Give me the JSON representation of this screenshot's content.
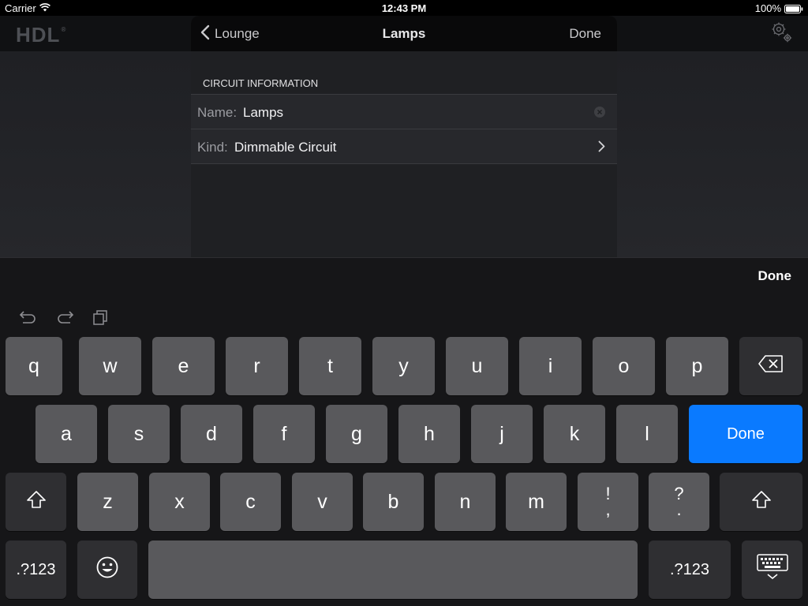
{
  "status_bar": {
    "carrier": "Carrier",
    "time": "12:43 PM",
    "battery": "100%"
  },
  "header": {
    "logo_text": "HDL",
    "logo_mark": "®",
    "settings_icon": "gear-icon"
  },
  "modal": {
    "back_label": "Lounge",
    "title": "Lamps",
    "done_label": "Done",
    "section_header": "CIRCUIT INFORMATION",
    "rows": [
      {
        "label": "Name:",
        "value": "Lamps"
      },
      {
        "label": "Kind:",
        "value": "Dimmable Circuit"
      }
    ]
  },
  "keyboard": {
    "done_label": "Done",
    "row1": [
      "q",
      "w",
      "e",
      "r",
      "t",
      "y",
      "u",
      "i",
      "o",
      "p"
    ],
    "row2": [
      "a",
      "s",
      "d",
      "f",
      "g",
      "h",
      "j",
      "k",
      "l"
    ],
    "return_label": "Done",
    "row3": [
      "z",
      "x",
      "c",
      "v",
      "b",
      "n",
      "m"
    ],
    "punct1": {
      "top": "!",
      "bottom": ","
    },
    "punct2": {
      "top": "?",
      "bottom": "."
    },
    "numbers_label": ".?123",
    "accent_color": "#0a7aff"
  }
}
